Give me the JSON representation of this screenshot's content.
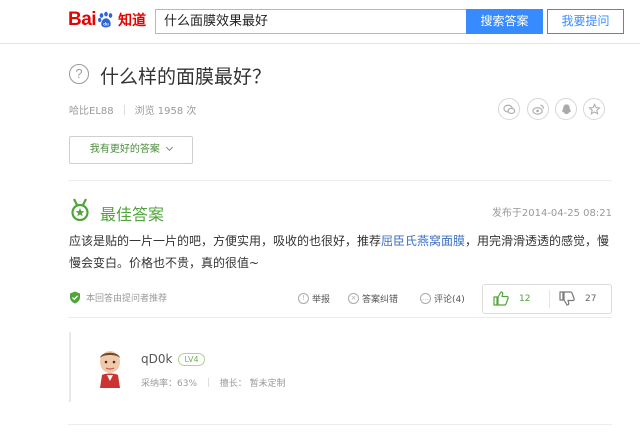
{
  "header": {
    "logo_prefix": "Bai",
    "logo_suffix": "du",
    "logo_product": "知道",
    "search_value": "什么面膜效果最好",
    "search_button": "搜索答案",
    "ask_button": "我要提问"
  },
  "question": {
    "icon": "question-circle-icon",
    "title": "什么样的面膜最好？",
    "asker": "哈比EL88",
    "views": "浏览 1958 次",
    "better_answer_button": "我有更好的答案",
    "share_icons": [
      "wechat-icon",
      "weibo-icon",
      "qq-icon",
      "star-icon"
    ]
  },
  "best_answer": {
    "title": "最佳答案",
    "time": "发布于2014-04-25 08:21",
    "text_before": "应该是贴的一片一片的吧，方便实用，吸收的也很好，推荐",
    "link_text": "屈臣氏燕窝面膜",
    "text_after": "，用完滑滑透透的感觉，慢慢会变白。价格也不贵，真的很值~",
    "recommend_note": "本回答由提问者推荐",
    "actions": {
      "report": "举报",
      "correct": "答案纠错",
      "comment": "评论(4)"
    },
    "votes": {
      "up": "12",
      "down": "27"
    }
  },
  "answerer": {
    "name": "qD0k",
    "level": "LV4",
    "stats": "采纳率：63%",
    "expertise": "擅长：",
    "expertise_value": "暂未定制"
  },
  "colors": {
    "accent_blue": "#388bff",
    "baidu_red": "#e10602",
    "green": "#4fa53b"
  }
}
